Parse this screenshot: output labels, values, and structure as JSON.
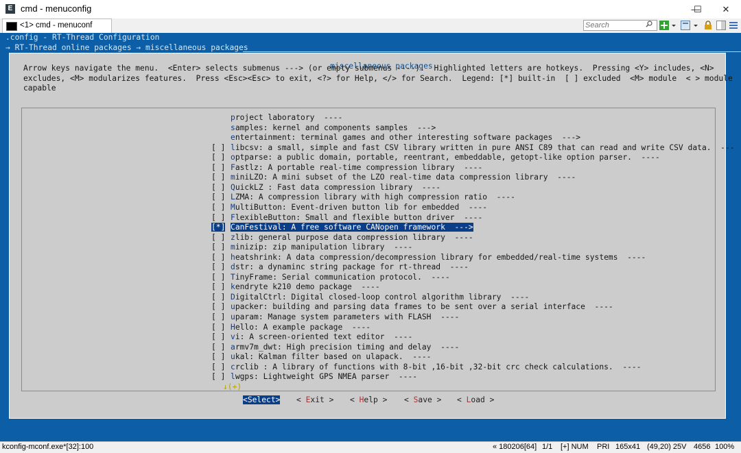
{
  "window": {
    "title": "cmd - menuconfig",
    "minimize": "—",
    "maximize": "☐",
    "close": "✕"
  },
  "toolbar": {
    "tab_label": "<1> cmd - menuconf",
    "search_placeholder": "Search"
  },
  "console": {
    "config_line": ".config - RT-Thread Configuration",
    "breadcrumb": "→ RT-Thread online packages → miscellaneous packages",
    "dialog_title": "miscellaneous packages",
    "help_lines": [
      "Arrow keys navigate the menu.  <Enter> selects submenus ---> (or empty submenus ----).  Highlighted letters are hotkeys.  Pressing <Y> includes, <N>",
      "excludes, <M> modularizes features.  Press <Esc><Esc> to exit, <?> for Help, </> for Search.  Legend: [*] built-in  [ ] excluded  <M> module  < > module",
      "capable"
    ],
    "items": [
      {
        "check": "",
        "hotkey": "p",
        "rest": "roject laboratory  ----"
      },
      {
        "check": "",
        "hotkey": "s",
        "rest": "amples: kernel and components samples  --->"
      },
      {
        "check": "",
        "hotkey": "e",
        "rest": "ntertainment: terminal games and other interesting software packages  --->"
      },
      {
        "check": "[ ]",
        "hotkey": "l",
        "rest": "ibcsv: a small, simple and fast CSV library written in pure ANSI C89 that can read and write CSV data.  ---"
      },
      {
        "check": "[ ]",
        "hotkey": "o",
        "rest": "ptparse: a public domain, portable, reentrant, embeddable, getopt-like option parser.  ----"
      },
      {
        "check": "[ ]",
        "hotkey": "F",
        "rest": "astlz: A portable real-time compression library  ----"
      },
      {
        "check": "[ ]",
        "hotkey": "m",
        "rest": "iniLZO: A mini subset of the LZO real-time data compression library  ----"
      },
      {
        "check": "[ ]",
        "hotkey": "Q",
        "rest": "uickLZ : Fast data compression library  ----"
      },
      {
        "check": "[ ]",
        "hotkey": "L",
        "rest": "ZMA: A compression library with high compression ratio  ----"
      },
      {
        "check": "[ ]",
        "hotkey": "M",
        "rest": "ultiButton: Event-driven button lib for embedded  ----"
      },
      {
        "check": "[ ]",
        "hotkey": "F",
        "rest": "lexibleButton: Small and flexible button driver  ----"
      },
      {
        "check": "[*]",
        "hotkey": "C",
        "rest": "anFestival: A free software CANopen framework  --->",
        "selected": true
      },
      {
        "check": "[ ]",
        "hotkey": "z",
        "rest": "lib: general purpose data compression library  ----"
      },
      {
        "check": "[ ]",
        "hotkey": "m",
        "rest": "inizip: zip manipulation library  ----"
      },
      {
        "check": "[ ]",
        "hotkey": "h",
        "rest": "eatshrink: A data compression/decompression library for embedded/real-time systems  ----"
      },
      {
        "check": "[ ]",
        "hotkey": "d",
        "rest": "str: a dynaminc string package for rt-thread  ----"
      },
      {
        "check": "[ ]",
        "hotkey": "T",
        "rest": "inyFrame: Serial communication protocol.  ----"
      },
      {
        "check": "[ ]",
        "hotkey": "k",
        "rest": "endryte k210 demo package  ----"
      },
      {
        "check": "[ ]",
        "hotkey": "D",
        "rest": "igitalCtrl: Digital closed-loop control algorithm library  ----"
      },
      {
        "check": "[ ]",
        "hotkey": "u",
        "rest": "packer: building and parsing data frames to be sent over a serial interface  ----"
      },
      {
        "check": "[ ]",
        "hotkey": "u",
        "rest": "param: Manage system parameters with FLASH  ----"
      },
      {
        "check": "[ ]",
        "hotkey": "H",
        "rest": "ello: A example package  ----"
      },
      {
        "check": "[ ]",
        "hotkey": "v",
        "rest": "i: A screen-oriented text editor  ----"
      },
      {
        "check": "[ ]",
        "hotkey": "a",
        "rest": "rmv7m_dwt: High precision timing and delay  ----"
      },
      {
        "check": "[ ]",
        "hotkey": "u",
        "rest": "kal: Kalman filter based on ulapack.  ----"
      },
      {
        "check": "[ ]",
        "hotkey": "c",
        "rest": "rclib : A library of functions with 8-bit ,16-bit ,32-bit crc check calculations.  ----"
      },
      {
        "check": "[ ]",
        "hotkey": "l",
        "rest": "wgps: Lightweight GPS NMEA parser  ----"
      }
    ],
    "more_indicator": "↓(+)",
    "buttons": [
      {
        "pre": "<",
        "hotkey": "S",
        "post": "elect>",
        "active": true
      },
      {
        "pre": "< ",
        "hotkey": "E",
        "post": "xit >",
        "active": false
      },
      {
        "pre": "< ",
        "hotkey": "H",
        "post": "elp >",
        "active": false
      },
      {
        "pre": "< ",
        "hotkey": "S",
        "post": "ave >",
        "active": false
      },
      {
        "pre": "< ",
        "hotkey": "L",
        "post": "oad >",
        "active": false
      }
    ]
  },
  "statusbar": {
    "process": "kconfig-mconf.exe*[32]:100",
    "position": "« 180206[64]",
    "page": "1/1",
    "mode": "[+] NUM",
    "priority": "PRI",
    "size": "165x41",
    "cursor": "(49,20) 25V",
    "pid": "4656",
    "zoom": "100%"
  },
  "colors": {
    "console_bg": "#0c5fa6",
    "dialog_bg": "#cccccc",
    "selection_bg": "#0b3e88",
    "hotkey": "#0c3d8a"
  }
}
